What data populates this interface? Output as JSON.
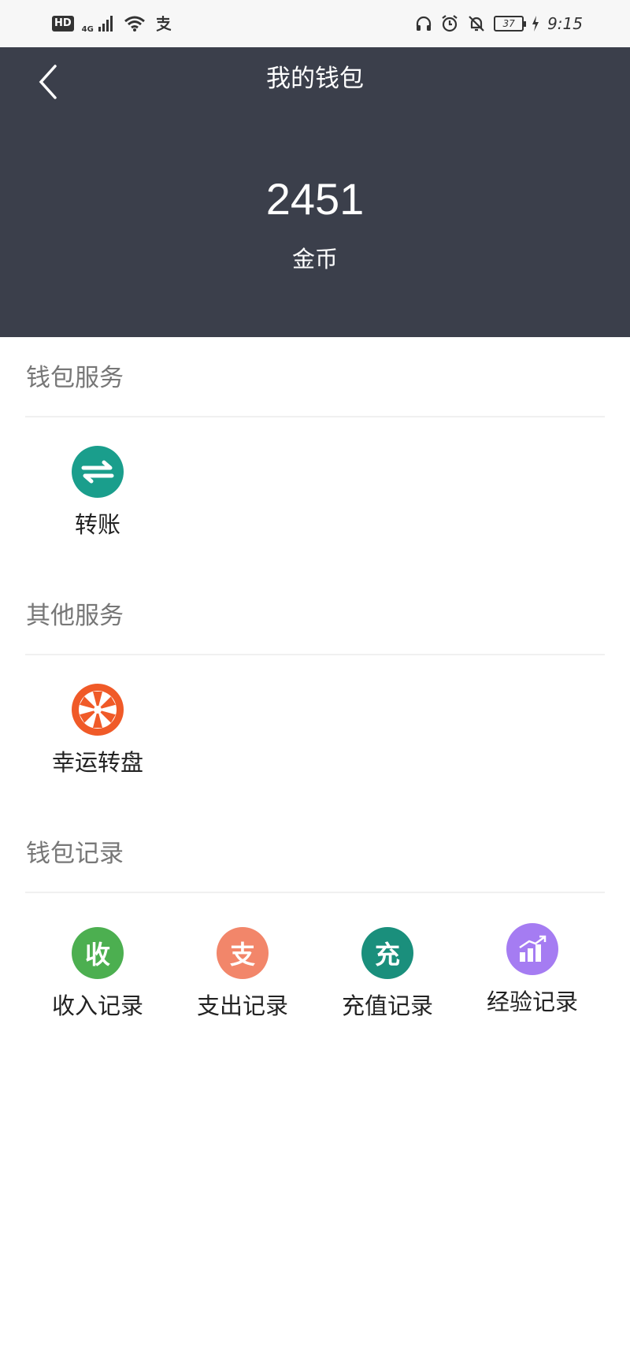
{
  "status_bar": {
    "hd": "HD",
    "network": "4G",
    "clock": "9:15",
    "battery": "37"
  },
  "header": {
    "title": "我的钱包",
    "balance": "2451",
    "balance_unit": "金币"
  },
  "sections": {
    "wallet_services": {
      "title": "钱包服务",
      "items": [
        {
          "label": "转账",
          "icon": "transfer-arrows-icon",
          "color": "#1a9e8c"
        }
      ]
    },
    "other_services": {
      "title": "其他服务",
      "items": [
        {
          "label": "幸运转盘",
          "icon": "lucky-wheel-icon",
          "color": "#f05a28"
        }
      ]
    },
    "wallet_records": {
      "title": "钱包记录",
      "items": [
        {
          "label": "收入记录",
          "glyph": "收",
          "icon": "income-icon",
          "color": "#4caf50"
        },
        {
          "label": "支出记录",
          "glyph": "支",
          "icon": "expense-icon",
          "color": "#f2866a"
        },
        {
          "label": "充值记录",
          "glyph": "充",
          "icon": "recharge-icon",
          "color": "#1a8f7c"
        },
        {
          "label": "经验记录",
          "icon": "bar-chart-up-icon",
          "color": "#a57cf2"
        }
      ]
    }
  }
}
